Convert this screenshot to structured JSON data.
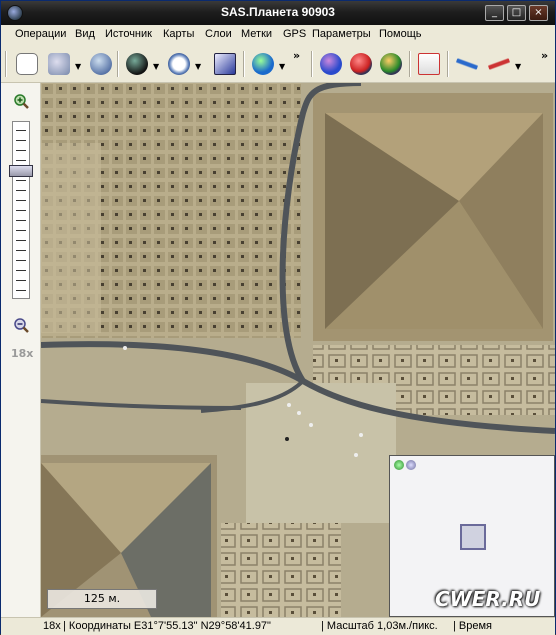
{
  "window": {
    "title": "SAS.Планета 90903",
    "minimize": "_",
    "maximize": "□",
    "close": "×"
  },
  "menu": [
    "Операции",
    "Вид",
    "Источник",
    "Карты",
    "Слои",
    "Метки",
    "GPS",
    "Параметры",
    "Помощь"
  ],
  "toolbar": {
    "icons": [
      "hand-icon",
      "satellite-source-icon",
      "globe-map-icon",
      "black-sphere-icon",
      "magnifier-icon",
      "screen-icon",
      "earth-globe-icon",
      "marker-icon",
      "marker-edit-icon",
      "marker-refresh-icon",
      "document-icon",
      "gps-track-icon",
      "path-icon"
    ],
    "more": "»"
  },
  "zoom_panel": {
    "level": "18x"
  },
  "map": {
    "scale_label": "125 м."
  },
  "statusbar": {
    "zoom": "18x",
    "coords": "| Координаты E31°7'55.13\" N29°58'41.97\"",
    "scale": "| Масштаб 1,03м./пикс.",
    "extra": "| Время"
  },
  "watermark": "CWER.RU",
  "colors": {
    "titlebar": "#1e1e1e",
    "chrome": "#ECE9D8",
    "map_sand": "#b7ae92",
    "road": "#4f5459"
  }
}
